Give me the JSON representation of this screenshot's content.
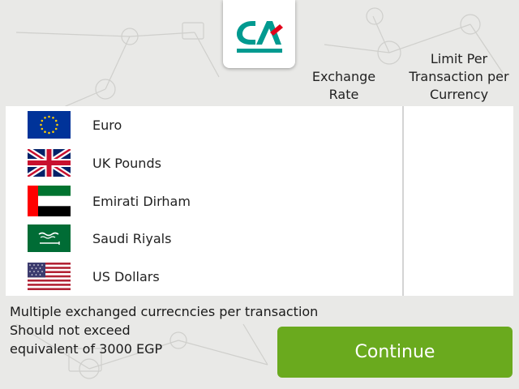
{
  "brand": {
    "logo_text": "CA",
    "primary_color": "#009a90",
    "secondary_color": "#e2001a"
  },
  "columns": {
    "exchange_rate": "Exchange Rate",
    "limit": "Limit Per Transaction per Currency"
  },
  "currencies": [
    {
      "name": "Euro",
      "flag": "eu-flag-icon"
    },
    {
      "name": "UK Pounds",
      "flag": "uk-flag-icon"
    },
    {
      "name": "Emirati Dirham",
      "flag": "uae-flag-icon"
    },
    {
      "name": "Saudi Riyals",
      "flag": "saudi-flag-icon"
    },
    {
      "name": "US Dollars",
      "flag": "us-flag-icon"
    }
  ],
  "note": [
    "Multiple exchanged currecncies per transaction",
    "Should not exceed",
    "equivalent of 3000 EGP"
  ],
  "continue_label": "Continue",
  "colors": {
    "button": "#6aaa1e",
    "background": "#e9e9e7"
  }
}
